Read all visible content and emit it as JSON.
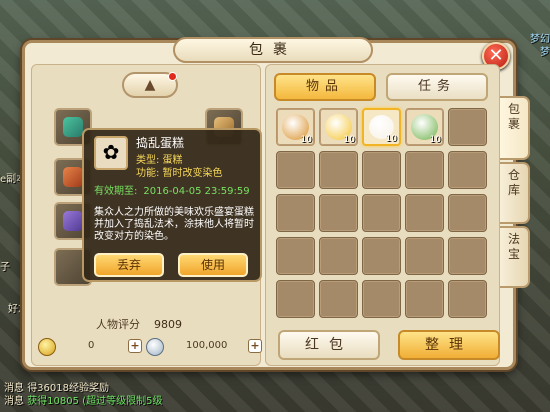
{
  "window": {
    "title": "包裹",
    "close_label": "✕"
  },
  "background": {
    "left_text_1": "e副本",
    "left_text_2": "子",
    "left_text_3": "好友",
    "right_text_1": "梦幻",
    "right_text_2": "梦",
    "chat": [
      {
        "prefix": "消息",
        "text": "得36018经验奖励"
      },
      {
        "prefix": "消息",
        "text": "获得10805 (超过等级限制5级"
      }
    ]
  },
  "character": {
    "rating_label": "人物评分",
    "rating_value": "9809"
  },
  "currency": {
    "gold_value": "0",
    "silver_value": "100,000",
    "plus_label": "+"
  },
  "tooltip": {
    "item_name": "捣乱蛋糕",
    "type_line": "类型: 蛋糕",
    "function_line": "功能: 暂时改变染色",
    "expire_label": "有效期至:",
    "expire_value": "2016-04-05 23:59:59",
    "description": "集众人之力所做的美味欢乐盛宴蛋糕并加入了捣乱法术，涂抹他人将暂时改变对方的染色。",
    "discard_label": "丢弃",
    "use_label": "使用"
  },
  "tabs": {
    "items_label": "物品",
    "tasks_label": "任务"
  },
  "side_tabs": [
    {
      "label": "包\n裹",
      "active": true
    },
    {
      "label": "仓\n库",
      "active": false
    },
    {
      "label": "法\n宝",
      "active": false
    }
  ],
  "inventory": {
    "slots": [
      {
        "filled": true,
        "icon": "treasure-chest-icon",
        "count": "10",
        "color": "#d9902a"
      },
      {
        "filled": true,
        "icon": "golden-orb-icon",
        "count": "10",
        "color": "#f4c430"
      },
      {
        "filled": true,
        "icon": "cake-icon",
        "count": "10",
        "color": "#f7f1e6",
        "selected": true
      },
      {
        "filled": true,
        "icon": "gourd-icon",
        "count": "10",
        "color": "#6fb24b"
      }
    ]
  },
  "buttons": {
    "red_packet_label": "红包",
    "arrange_label": "整理"
  }
}
